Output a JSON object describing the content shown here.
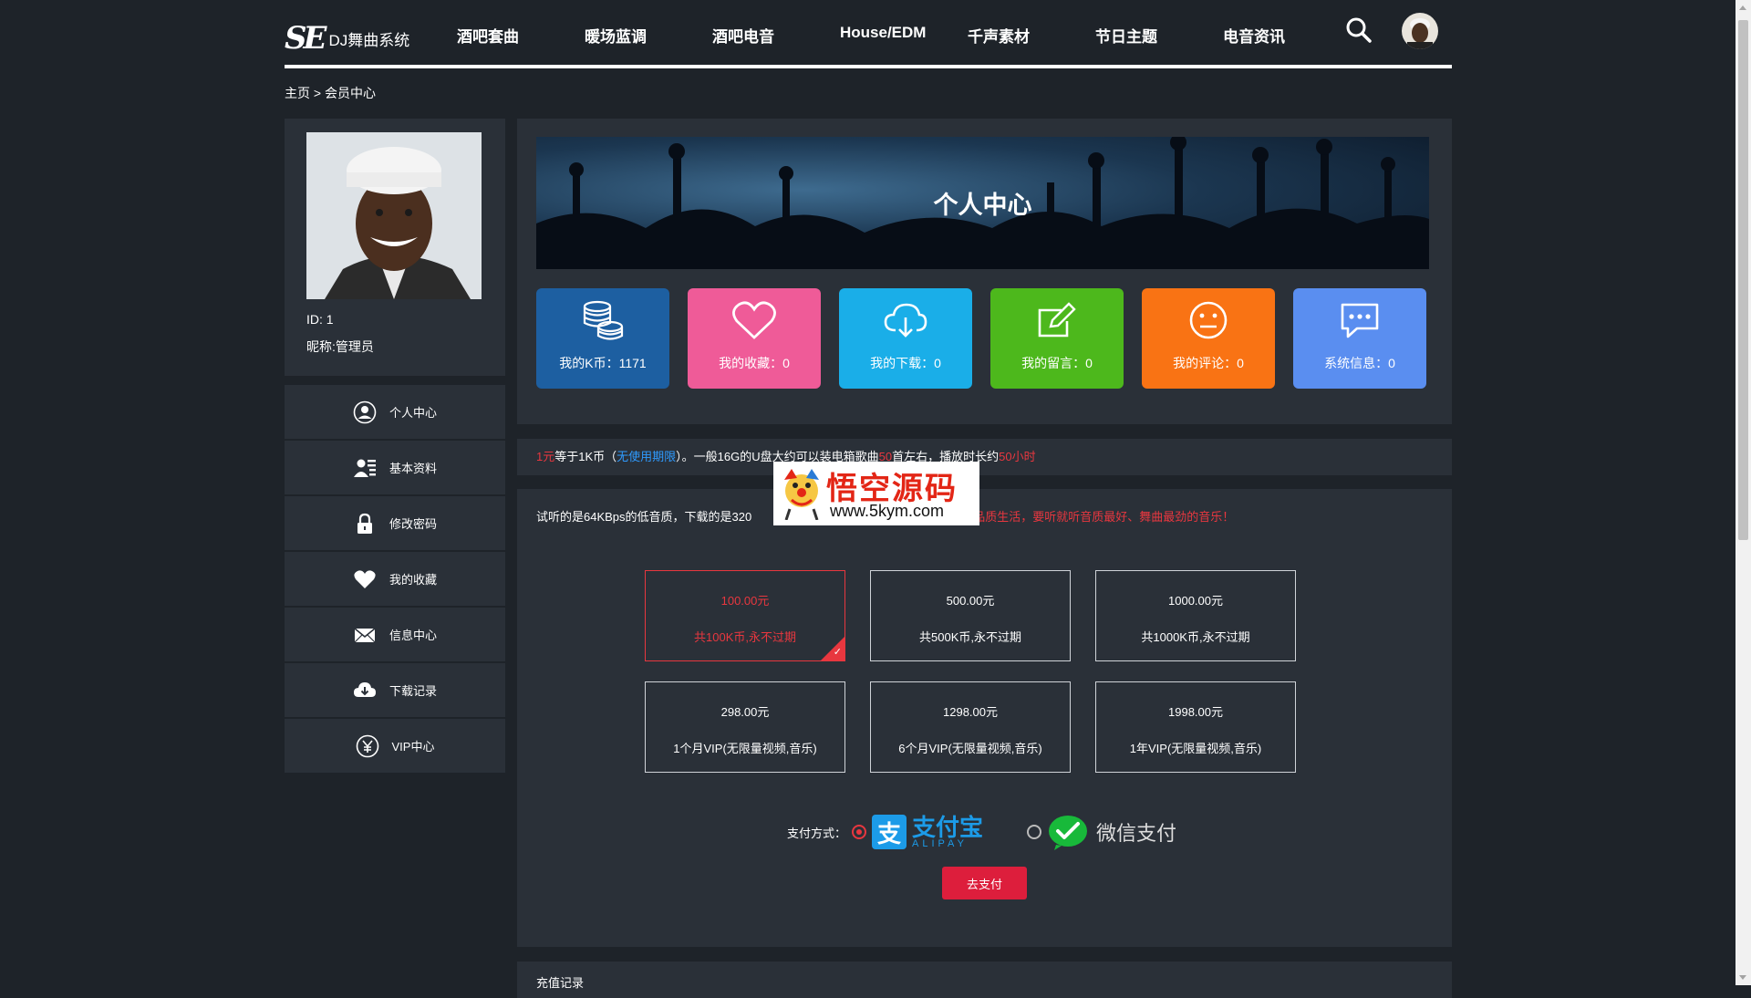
{
  "header": {
    "logo_mark": "SE",
    "logo_text": "DJ舞曲系统",
    "nav": [
      "酒吧套曲",
      "暖场蓝调",
      "酒吧电音",
      "House/EDM",
      "千声素材",
      "节日主题",
      "电音资讯"
    ],
    "icons": {
      "search": "search-icon",
      "user": "user-avatar"
    }
  },
  "breadcrumb": "主页 > 会员中心",
  "profile": {
    "id_label": "ID: 1",
    "nickname_label": "昵称:管理员"
  },
  "menu": [
    {
      "label": "个人中心",
      "icon": "user-circle-icon"
    },
    {
      "label": "基本资料",
      "icon": "profile-card-icon"
    },
    {
      "label": "修改密码",
      "icon": "lock-icon"
    },
    {
      "label": "我的收藏",
      "icon": "heart-icon"
    },
    {
      "label": "信息中心",
      "icon": "envelope-icon"
    },
    {
      "label": "下载记录",
      "icon": "cloud-download-icon"
    },
    {
      "label": "VIP中心",
      "icon": "yen-icon"
    }
  ],
  "banner": {
    "title": "个人中心"
  },
  "tiles": [
    {
      "label": "我的K币：1171",
      "color": "#1d5fa1",
      "icon": "coins-icon"
    },
    {
      "label": "我的收藏：0",
      "color": "#ef5b98",
      "icon": "heart-outline-icon"
    },
    {
      "label": "我的下载：0",
      "color": "#1aaee8",
      "icon": "cloud-download-icon"
    },
    {
      "label": "我的留言：0",
      "color": "#4db81c",
      "icon": "edit-icon"
    },
    {
      "label": "我的评论：0",
      "color": "#f97314",
      "icon": "smile-icon"
    },
    {
      "label": "系统信息：0",
      "color": "#5a8ef0",
      "icon": "chat-icon"
    }
  ],
  "notice": {
    "p1": "1元",
    "p2": "等于1K币（",
    "p3": "无使用期限",
    "p4": "）。一般16G的U盘大约可以装电箱歌曲",
    "p5": "50",
    "p6": "首左右，播放时长约",
    "p7": "50小时"
  },
  "pay": {
    "desc_a": "试听的是64KBps的低音质，下载的是320",
    "desc_b": "高品质生活，要听就听音质最好、舞曲最劲的音乐！",
    "watermark_title": "悟空源码",
    "watermark_url": "www.5kym.com",
    "plans": [
      {
        "price": "100.00元",
        "desc": "共100K币,永不过期",
        "selected": true
      },
      {
        "price": "500.00元",
        "desc": "共500K币,永不过期",
        "selected": false
      },
      {
        "price": "1000.00元",
        "desc": "共1000K币,永不过期",
        "selected": false
      },
      {
        "price": "298.00元",
        "desc": "1个月VIP(无限量视频,音乐)",
        "selected": false
      },
      {
        "price": "1298.00元",
        "desc": "6个月VIP(无限量视频,音乐)",
        "selected": false
      },
      {
        "price": "1998.00元",
        "desc": "1年VIP(无限量视频,音乐)",
        "selected": false
      }
    ],
    "method_label": "支付方式：",
    "alipay_cn": "支付宝",
    "alipay_en": "ALIPAY",
    "wechat": "微信支付",
    "submit": "去支付"
  },
  "records_title": "充值记录"
}
